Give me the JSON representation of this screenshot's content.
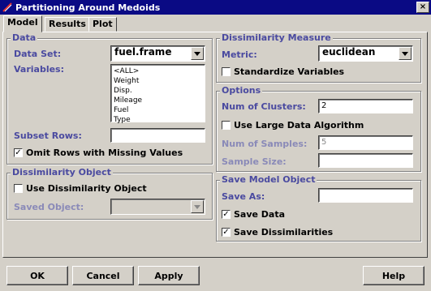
{
  "window": {
    "title": "Partitioning Around Medoids",
    "close_glyph": "×"
  },
  "tabs": [
    {
      "label": "Model"
    },
    {
      "label": "Results"
    },
    {
      "label": "Plot"
    }
  ],
  "data_group": {
    "title": "Data",
    "data_set_label": "Data Set:",
    "data_set_value": "fuel.frame",
    "variables_label": "Variables:",
    "variables": [
      "<ALL>",
      "Weight",
      "Disp.",
      "Mileage",
      "Fuel",
      "Type"
    ],
    "subset_rows_label": "Subset Rows:",
    "subset_rows_value": "",
    "omit_rows_label": "Omit Rows with Missing Values",
    "omit_rows_checked": "✓"
  },
  "dissimilarity_object": {
    "title": "Dissimilarity Object",
    "use_label": "Use Dissimilarity Object",
    "use_checked": "",
    "saved_object_label": "Saved Object:",
    "saved_object_value": ""
  },
  "dissimilarity_measure": {
    "title": "Dissimilarity Measure",
    "metric_label": "Metric:",
    "metric_value": "euclidean",
    "standardize_label": "Standardize Variables",
    "standardize_checked": ""
  },
  "options": {
    "title": "Options",
    "num_clusters_label": "Num of Clusters:",
    "num_clusters_value": "2",
    "large_data_label": "Use Large Data Algorithm",
    "large_data_checked": "",
    "num_samples_label": "Num of Samples:",
    "num_samples_value": "5",
    "sample_size_label": "Sample Size:",
    "sample_size_value": ""
  },
  "save_model": {
    "title": "Save Model Object",
    "save_as_label": "Save As:",
    "save_as_value": "",
    "save_data_label": "Save Data",
    "save_data_checked": "✓",
    "save_dissim_label": "Save Dissimilarities",
    "save_dissim_checked": "✓"
  },
  "buttons": {
    "ok": "OK",
    "cancel": "Cancel",
    "apply": "Apply",
    "help": "Help"
  }
}
